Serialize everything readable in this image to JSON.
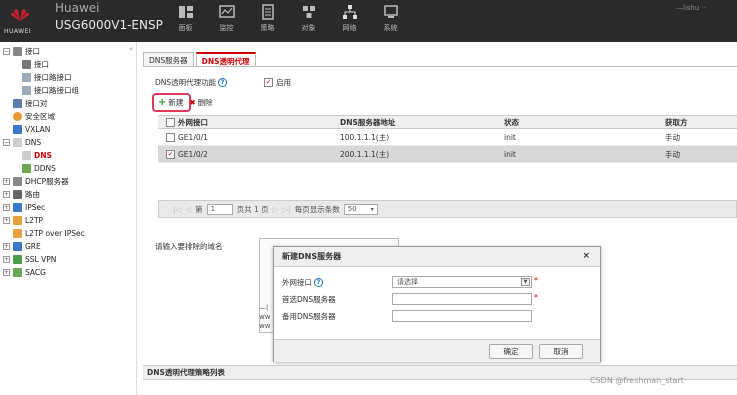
{
  "header": {
    "brand_name": "Huawei",
    "brand_logo_text": "HUAWEI",
    "model": "USG6000V1-ENSP",
    "nav": [
      {
        "label": "面板",
        "icon": "dashboard-icon"
      },
      {
        "label": "监控",
        "icon": "monitor-icon"
      },
      {
        "label": "策略",
        "icon": "policy-icon"
      },
      {
        "label": "对象",
        "icon": "object-icon"
      },
      {
        "label": "网络",
        "icon": "network-icon"
      },
      {
        "label": "系统",
        "icon": "system-icon"
      }
    ],
    "user_text": "—lishu ··"
  },
  "sidebar": {
    "items": [
      {
        "label": "接口",
        "icon": "interface-icon"
      },
      {
        "label": "接口",
        "icon": "interface-icon"
      },
      {
        "label": "接口路接口",
        "icon": "bridge-icon"
      },
      {
        "label": "接口路接口组",
        "icon": "bridge-group-icon"
      },
      {
        "label": "接口对",
        "icon": "interface-pair-icon"
      },
      {
        "label": "安全区域",
        "icon": "security-zone-icon"
      },
      {
        "label": "VXLAN",
        "icon": "vxlan-icon"
      },
      {
        "label": "DNS",
        "icon": "dns-icon"
      },
      {
        "label": "DNS",
        "icon": "dns-icon"
      },
      {
        "label": "DDNS",
        "icon": "ddns-icon"
      },
      {
        "label": "DHCP服务器",
        "icon": "dhcp-icon"
      },
      {
        "label": "路由",
        "icon": "route-icon"
      },
      {
        "label": "IPSec",
        "icon": "ipsec-icon"
      },
      {
        "label": "L2TP",
        "icon": "l2tp-icon"
      },
      {
        "label": "L2TP over IPSec",
        "icon": "l2tp-ipsec-icon"
      },
      {
        "label": "GRE",
        "icon": "gre-icon"
      },
      {
        "label": "SSL VPN",
        "icon": "sslvpn-icon"
      },
      {
        "label": "SACG",
        "icon": "sacg-icon"
      }
    ],
    "collapse": "«"
  },
  "tabs": [
    {
      "label": "DNS服务器"
    },
    {
      "label": "DNS透明代理"
    }
  ],
  "enable_row": {
    "label": "DNS透明代理功能",
    "checkbox_label": "启用",
    "checked": true
  },
  "toolbar": {
    "new_label": "新建",
    "delete_label": "删除"
  },
  "table": {
    "columns": [
      "外网接口",
      "DNS服务器地址",
      "状态",
      "获取方"
    ],
    "rows": [
      {
        "iface": "GE1/0/1",
        "dns": "100.1.1.1(主)",
        "status": "init",
        "mode": "手动",
        "checked": false
      },
      {
        "iface": "GE1/0/2",
        "dns": "200.1.1.1(主)",
        "status": "init",
        "mode": "手动",
        "checked": true
      }
    ]
  },
  "pager": {
    "prefix": "第",
    "page": "1",
    "total": "页共 1 页",
    "per_page_label": "每页显示条数",
    "per_page": "50"
  },
  "exclude": {
    "label": "请输入要排除的域名",
    "frag1": "—(",
    "frag2": "ww",
    "frag3": "ww"
  },
  "dialog": {
    "title": "新建DNS服务器",
    "close": "×",
    "fields": [
      {
        "label": "外网接口",
        "value": "请选择"
      },
      {
        "label": "首选DNS服务器",
        "value": ""
      },
      {
        "label": "备用DNS服务器",
        "value": ""
      }
    ],
    "ok": "确定",
    "cancel": "取消"
  },
  "policy_list": {
    "title": "DNS透明代理策略列表"
  },
  "watermark": "CSDN @freshman_start"
}
